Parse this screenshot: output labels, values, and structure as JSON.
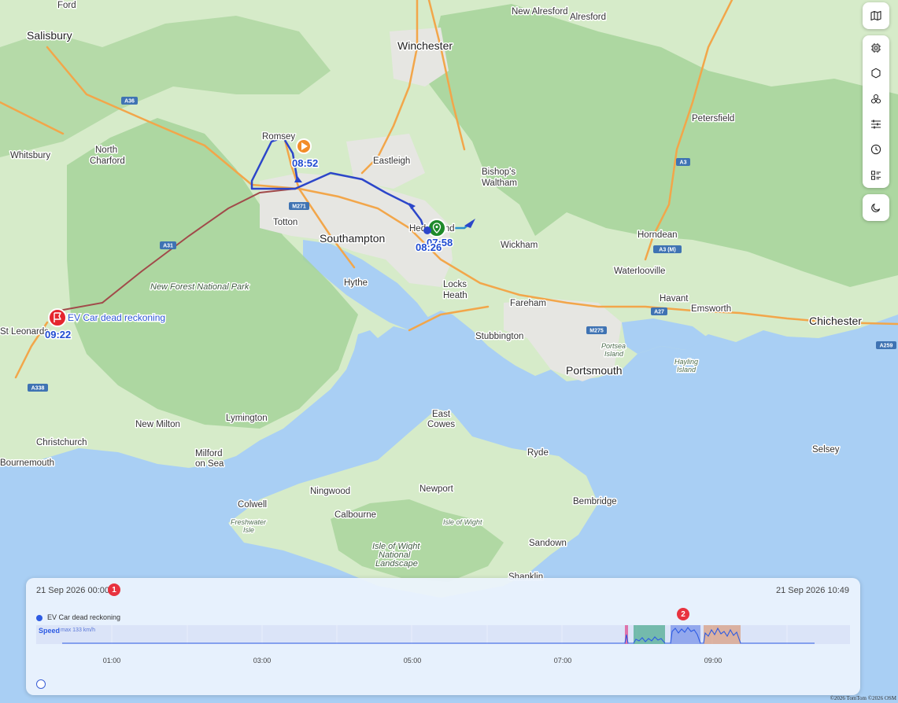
{
  "map": {
    "places": [
      {
        "name": "Ford",
        "kind": "town"
      },
      {
        "name": "New Alresford",
        "kind": "town"
      },
      {
        "name": "Alresford",
        "kind": "town"
      },
      {
        "name": "Salisbury",
        "kind": "city"
      },
      {
        "name": "Winchester",
        "kind": "city"
      },
      {
        "name": "Petersfield",
        "kind": "town"
      },
      {
        "name": "Whitsbury",
        "kind": "town"
      },
      {
        "name": "North",
        "kind": "town"
      },
      {
        "name": "Charford",
        "kind": "town"
      },
      {
        "name": "Romsey",
        "kind": "town"
      },
      {
        "name": "Eastleigh",
        "kind": "town"
      },
      {
        "name": "Bishop's",
        "kind": "town"
      },
      {
        "name": "Waltham",
        "kind": "town"
      },
      {
        "name": "Totton",
        "kind": "town"
      },
      {
        "name": "Southampton",
        "kind": "city"
      },
      {
        "name": "Hedge End",
        "kind": "town"
      },
      {
        "name": "Wickham",
        "kind": "town"
      },
      {
        "name": "Horndean",
        "kind": "town"
      },
      {
        "name": "Waterlooville",
        "kind": "town"
      },
      {
        "name": "New Forest National Park",
        "kind": "park"
      },
      {
        "name": "Hythe",
        "kind": "town"
      },
      {
        "name": "Locks",
        "kind": "town"
      },
      {
        "name": "Heath",
        "kind": "town"
      },
      {
        "name": "Fareham",
        "kind": "town"
      },
      {
        "name": "Havant",
        "kind": "town"
      },
      {
        "name": "Emsworth",
        "kind": "town"
      },
      {
        "name": "Chichester",
        "kind": "city"
      },
      {
        "name": "St Leonards",
        "kind": "town"
      },
      {
        "name": "Stubbington",
        "kind": "town"
      },
      {
        "name": "Portsea",
        "kind": "island"
      },
      {
        "name": "Island",
        "kind": "island"
      },
      {
        "name": "Portsmouth",
        "kind": "city"
      },
      {
        "name": "Hayling",
        "kind": "island"
      },
      {
        "name": "Island",
        "kind": "island"
      },
      {
        "name": "Lymington",
        "kind": "town"
      },
      {
        "name": "New Milton",
        "kind": "town"
      },
      {
        "name": "East",
        "kind": "town"
      },
      {
        "name": "Cowes",
        "kind": "town"
      },
      {
        "name": "Christchurch",
        "kind": "town"
      },
      {
        "name": "Milford",
        "kind": "town"
      },
      {
        "name": "on Sea",
        "kind": "town"
      },
      {
        "name": "Ryde",
        "kind": "town"
      },
      {
        "name": "Selsey",
        "kind": "town"
      },
      {
        "name": "Bournemouth",
        "kind": "town"
      },
      {
        "name": "Ningwood",
        "kind": "town"
      },
      {
        "name": "Newport",
        "kind": "town"
      },
      {
        "name": "Bembridge",
        "kind": "town"
      },
      {
        "name": "Colwell",
        "kind": "town"
      },
      {
        "name": "Freshwater",
        "kind": "island"
      },
      {
        "name": "Isle",
        "kind": "island"
      },
      {
        "name": "Calbourne",
        "kind": "town"
      },
      {
        "name": "Isle of Wight",
        "kind": "island"
      },
      {
        "name": "Isle of Wight",
        "kind": "park"
      },
      {
        "name": "National",
        "kind": "park"
      },
      {
        "name": "Landscape",
        "kind": "park"
      },
      {
        "name": "Sandown",
        "kind": "town"
      },
      {
        "name": "Shanklin",
        "kind": "town"
      }
    ],
    "road_shields": [
      "A36",
      "A3",
      "M271",
      "A31",
      "A3 (M)",
      "M275",
      "A27",
      "A259",
      "A338"
    ],
    "route": {
      "device_name": "EV Car dead reckoning",
      "times": [
        "08:52",
        "07:58",
        "08:26",
        "09:22"
      ],
      "color": "#2c46c9"
    },
    "markers": [
      {
        "type": "play-icon",
        "color": "#f28c28"
      },
      {
        "type": "pin-icon",
        "color": "#1e8a2a"
      },
      {
        "type": "flag-icon",
        "color": "#e5252e"
      }
    ]
  },
  "toolbar": {
    "groups": [
      [
        {
          "icon": "map-icon"
        }
      ],
      [
        {
          "icon": "chip-icon"
        },
        {
          "icon": "hexagon-icon"
        },
        {
          "icon": "cluster-icon"
        },
        {
          "icon": "sliders-icon"
        },
        {
          "icon": "clock-icon"
        },
        {
          "icon": "list-icon"
        }
      ],
      [
        {
          "icon": "moon-icon"
        }
      ]
    ]
  },
  "timeline": {
    "start_label": "21 Sep 2026 00:00",
    "end_label": "21 Sep 2026 10:49",
    "badge_1": "1",
    "badge_2": "2",
    "legend_label": "EV Car dead reckoning",
    "speed_label": "Speed",
    "speed_max_label": "max 133 km/h",
    "ticks": [
      "01:00",
      "03:00",
      "05:00",
      "07:00",
      "09:00"
    ],
    "segment_colors": [
      "#e0448a",
      "#2f9e7a",
      "#3b5fe0",
      "#d9875a"
    ],
    "line_color": "#2d5be3"
  },
  "attribution": "©2026 TomTom ©2026 OSM"
}
